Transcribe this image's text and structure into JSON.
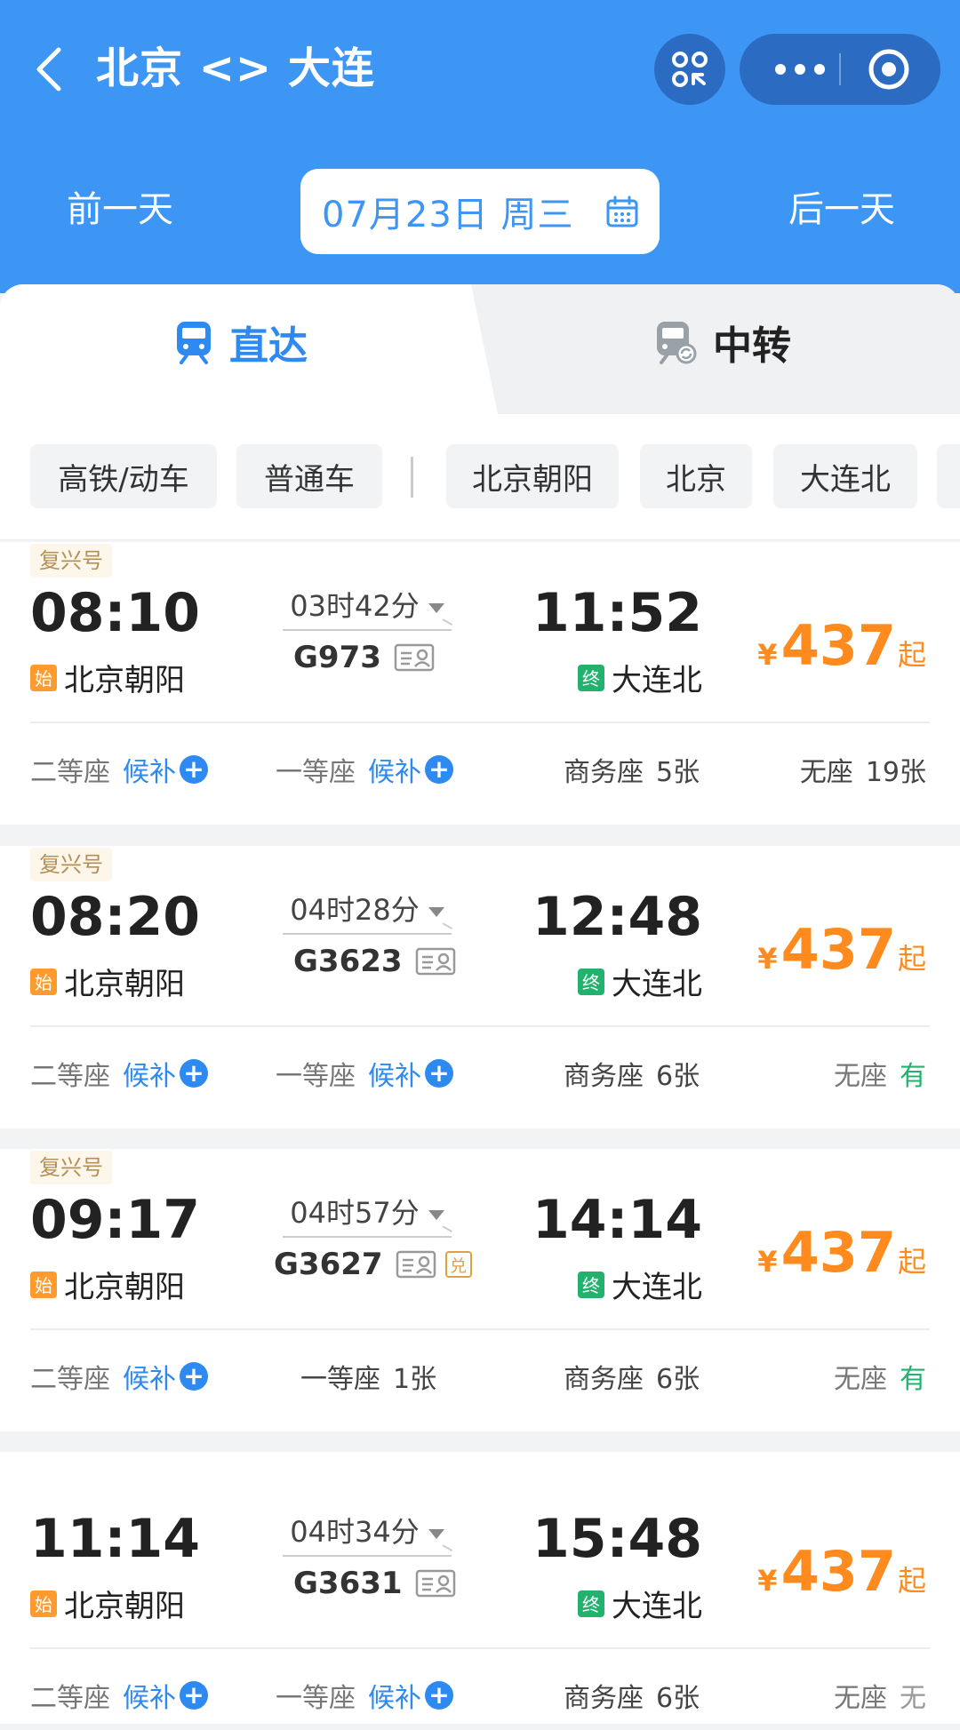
{
  "header": {
    "title": "北京 <> 大连",
    "prev_day": "前一天",
    "next_day": "后一天",
    "date": "07月23日 周三",
    "accent": "#3d95f4"
  },
  "tabs": [
    {
      "label": "直达",
      "icon": "train-icon",
      "active": true
    },
    {
      "label": "中转",
      "icon": "transfer-train-icon",
      "active": false
    }
  ],
  "filters": [
    "高铁/动车",
    "普通车",
    "北京朝阳",
    "北京",
    "大连北"
  ],
  "trains": [
    {
      "badge": "复兴号",
      "dep_time": "08:10",
      "dep_tag": "始",
      "dep_station": "北京朝阳",
      "duration": "03时42分",
      "train_no": "G973",
      "exchange": "",
      "arr_time": "11:52",
      "arr_tag": "终",
      "arr_station": "大连北",
      "price_symbol": "¥",
      "price": "437",
      "price_suffix": "起",
      "seats": [
        {
          "name": "二等座",
          "value": "候补",
          "kind": "wait"
        },
        {
          "name": "一等座",
          "value": "候补",
          "kind": "wait"
        },
        {
          "name": "商务座",
          "value": "5张",
          "kind": "cnt"
        },
        {
          "name": "无座",
          "value": "19张",
          "kind": "cnt"
        }
      ]
    },
    {
      "badge": "复兴号",
      "dep_time": "08:20",
      "dep_tag": "始",
      "dep_station": "北京朝阳",
      "duration": "04时28分",
      "train_no": "G3623",
      "exchange": "",
      "arr_time": "12:48",
      "arr_tag": "终",
      "arr_station": "大连北",
      "price_symbol": "¥",
      "price": "437",
      "price_suffix": "起",
      "seats": [
        {
          "name": "二等座",
          "value": "候补",
          "kind": "wait"
        },
        {
          "name": "一等座",
          "value": "候补",
          "kind": "wait"
        },
        {
          "name": "商务座",
          "value": "6张",
          "kind": "cnt"
        },
        {
          "name": "无座",
          "value": "有",
          "kind": "have"
        }
      ]
    },
    {
      "badge": "复兴号",
      "dep_time": "09:17",
      "dep_tag": "始",
      "dep_station": "北京朝阳",
      "duration": "04时57分",
      "train_no": "G3627",
      "exchange": "兑",
      "arr_time": "14:14",
      "arr_tag": "终",
      "arr_station": "大连北",
      "price_symbol": "¥",
      "price": "437",
      "price_suffix": "起",
      "seats": [
        {
          "name": "二等座",
          "value": "候补",
          "kind": "wait"
        },
        {
          "name": "一等座",
          "value": "1张",
          "kind": "cnt"
        },
        {
          "name": "商务座",
          "value": "6张",
          "kind": "cnt"
        },
        {
          "name": "无座",
          "value": "有",
          "kind": "have"
        }
      ]
    },
    {
      "badge": "",
      "dep_time": "11:14",
      "dep_tag": "始",
      "dep_station": "北京朝阳",
      "duration": "04时34分",
      "train_no": "G3631",
      "exchange": "",
      "arr_time": "15:48",
      "arr_tag": "终",
      "arr_station": "大连北",
      "price_symbol": "¥",
      "price": "437",
      "price_suffix": "起",
      "seats": [
        {
          "name": "二等座",
          "value": "候补",
          "kind": "wait"
        },
        {
          "name": "一等座",
          "value": "候补",
          "kind": "wait"
        },
        {
          "name": "商务座",
          "value": "6张",
          "kind": "cnt"
        },
        {
          "name": "无座",
          "value": "无",
          "kind": "none"
        }
      ]
    }
  ]
}
